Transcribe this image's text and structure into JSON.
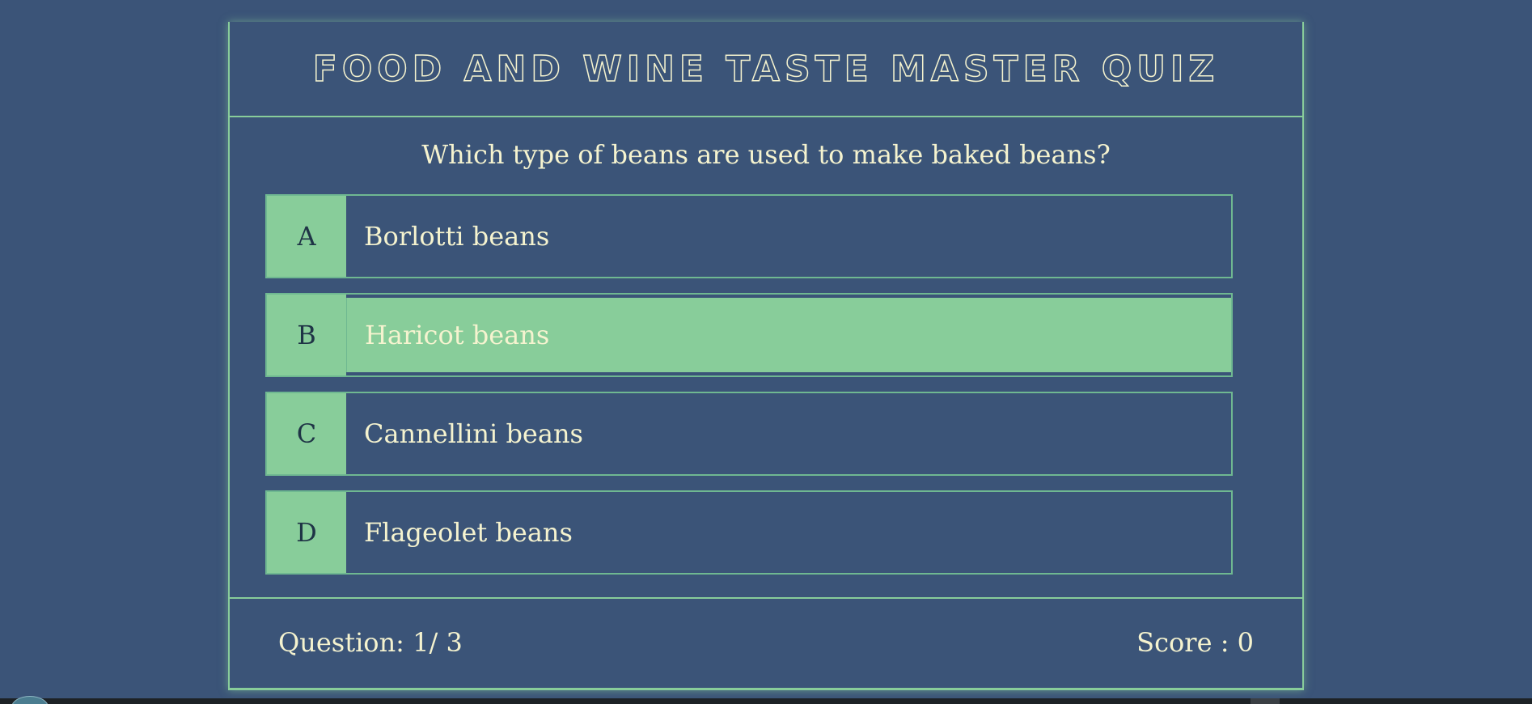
{
  "quiz": {
    "title": "Food and Wine Taste Master Quiz",
    "question": "Which type of beans are used to make baked beans?",
    "options": [
      {
        "letter": "A",
        "text": "Borlotti beans"
      },
      {
        "letter": "B",
        "text": "Haricot beans"
      },
      {
        "letter": "C",
        "text": "Cannellini beans"
      },
      {
        "letter": "D",
        "text": "Flageolet beans"
      }
    ],
    "selected_option": "B",
    "progress_text": "Question: 1/ 3",
    "score_text": "Score : 0"
  },
  "colors": {
    "background": "#3b5478",
    "accent": "#88cd9a",
    "text": "#f5f3cf",
    "letter_text": "#1f3446"
  }
}
